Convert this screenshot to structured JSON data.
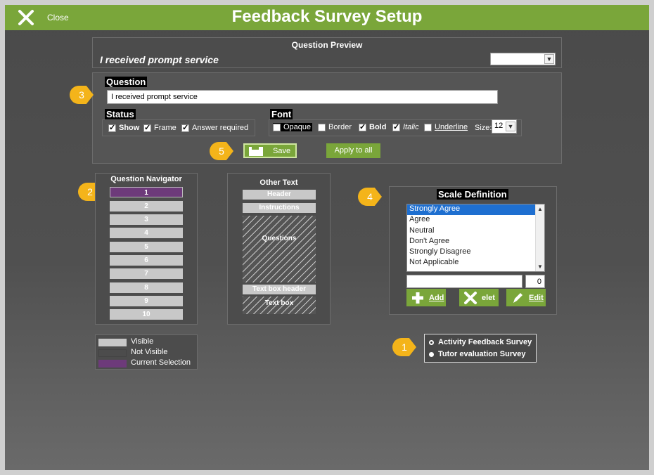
{
  "window": {
    "title": "Feedback Survey Setup",
    "close_label": "Close"
  },
  "preview": {
    "title": "Question Preview",
    "text": "I received prompt service",
    "select_value": ""
  },
  "question": {
    "label": "Question",
    "value": "I received prompt service"
  },
  "status": {
    "label": "Status",
    "show": {
      "label": "Show",
      "checked": true
    },
    "frame": {
      "label": "Frame",
      "checked": true
    },
    "required": {
      "label": "Answer required",
      "checked": true
    }
  },
  "font": {
    "label": "Font",
    "opaque": "Opaque",
    "border": "Border",
    "bold": "Bold",
    "italic": "Italic",
    "underline": "Underline",
    "size_label": "Size:",
    "size_value": "12"
  },
  "buttons": {
    "save": "Save",
    "apply_all": "Apply to all",
    "add": "Add",
    "delete": "elet",
    "edit": "Edit"
  },
  "navigator": {
    "title": "Question Navigator",
    "items": [
      "1",
      "2",
      "3",
      "4",
      "5",
      "6",
      "7",
      "8",
      "9",
      "10"
    ],
    "selected": "1"
  },
  "other_text": {
    "title": "Other Text",
    "header": "Header",
    "instructions": "Instructions",
    "questions": "Questions",
    "text_box_header": "Text box header",
    "text_box": "Text box"
  },
  "legend": {
    "visible": "Visible",
    "not_visible": "Not Visible",
    "current": "Current Selection",
    "colors": {
      "visible": "#c8c8c8",
      "not_visible": "#4c4c4c",
      "current": "#6d3a7a"
    }
  },
  "scale": {
    "title": "Scale Definition",
    "items": [
      "Strongly Agree",
      "Agree",
      "Neutral",
      "Don't Agree",
      "Strongly Disagree",
      "Not Applicable"
    ],
    "selected_index": 0,
    "text_value": "",
    "score_value": "0"
  },
  "surveys": {
    "items": [
      "Activity Feedback Survey",
      "Tutor evaluation Survey"
    ],
    "selected_index": 0
  },
  "badges": {
    "b1": "1",
    "b2": "2",
    "b3": "3",
    "b4": "4",
    "b5": "5"
  },
  "colors": {
    "accent": "#7aa63a",
    "badge": "#f4b41a",
    "selection": "#1e6fd0"
  }
}
